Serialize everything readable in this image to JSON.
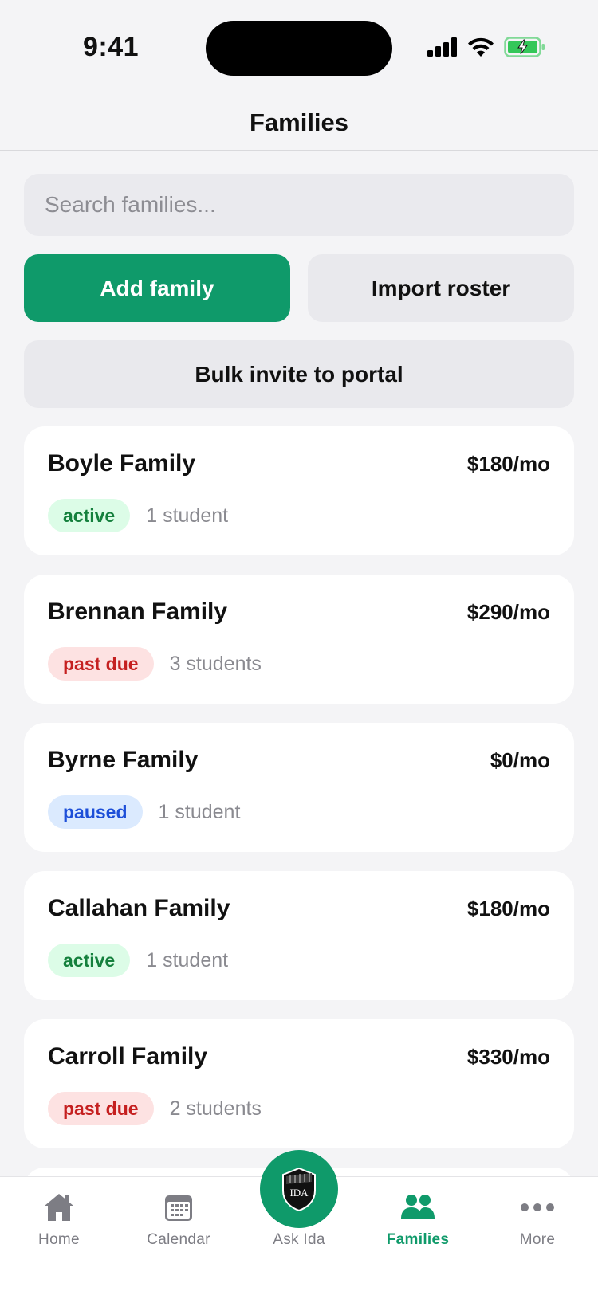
{
  "status_bar": {
    "time": "9:41"
  },
  "nav": {
    "title": "Families"
  },
  "search": {
    "placeholder": "Search families..."
  },
  "actions": {
    "add_family": "Add family",
    "import_roster": "Import roster",
    "bulk_invite": "Bulk invite to portal"
  },
  "families": [
    {
      "name": "Boyle Family",
      "price": "$180/mo",
      "status": "active",
      "students": "1 student"
    },
    {
      "name": "Brennan Family",
      "price": "$290/mo",
      "status": "past due",
      "students": "3 students"
    },
    {
      "name": "Byrne Family",
      "price": "$0/mo",
      "status": "paused",
      "students": "1 student"
    },
    {
      "name": "Callahan Family",
      "price": "$180/mo",
      "status": "active",
      "students": "1 student"
    },
    {
      "name": "Carroll Family",
      "price": "$330/mo",
      "status": "past due",
      "students": "2 students"
    }
  ],
  "tabs": {
    "home": "Home",
    "calendar": "Calendar",
    "ask_ida": "Ask Ida",
    "families": "Families",
    "more": "More",
    "selected": "families"
  },
  "logo": {
    "text": "IDA"
  },
  "colors": {
    "accent": "#0f9a6a",
    "active_bg": "#dcfce7",
    "past_due_bg": "#fde2e2",
    "paused_bg": "#dbeafe"
  }
}
